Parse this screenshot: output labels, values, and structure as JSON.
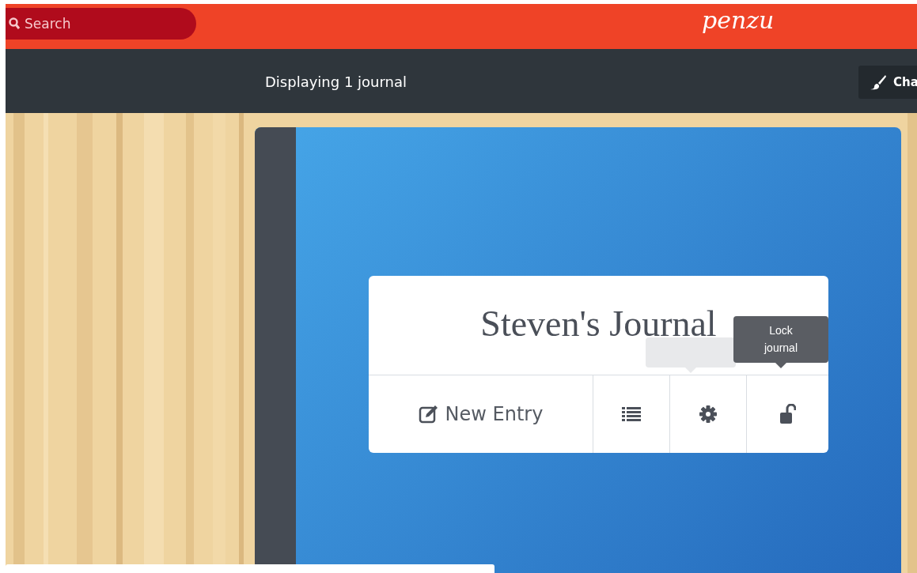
{
  "header": {
    "search": {
      "placeholder": "Search"
    },
    "logo": "penzu"
  },
  "toolbar": {
    "status": "Displaying 1 journal",
    "button": "Cha"
  },
  "journal": {
    "title": "Steven's Journal",
    "actions": [
      {
        "kind": "new_entry",
        "label": "New Entry"
      },
      {
        "kind": "list"
      },
      {
        "kind": "settings"
      },
      {
        "kind": "lock"
      }
    ],
    "tooltips": [
      {
        "active": false
      },
      {
        "text": "Lock journal",
        "active": true
      }
    ]
  }
}
